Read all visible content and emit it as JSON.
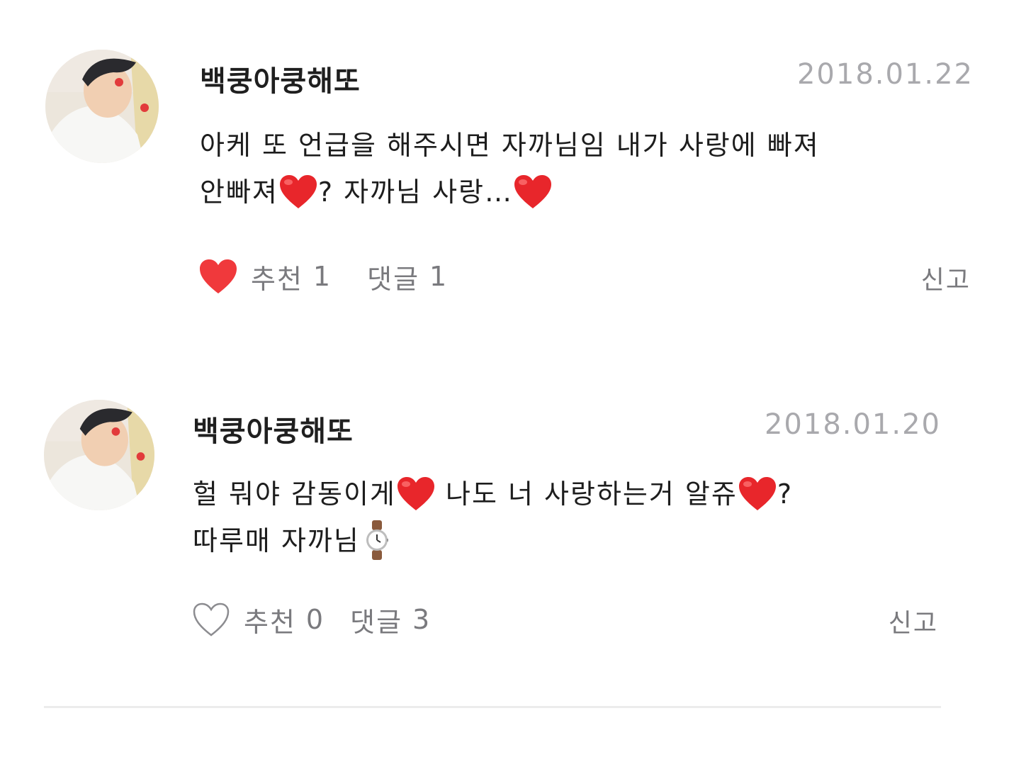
{
  "comments": [
    {
      "username": "백쿵아쿵해또",
      "date": "2018.01.22",
      "text_line1": "아케 또 언급을 해주시면 자까님임 내가 사랑에 빠져",
      "text_line2_a": "안빠져",
      "text_line2_b": "? 자까님 사랑…",
      "liked": true,
      "like_label": "추천",
      "like_count": "1",
      "reply_label": "댓글",
      "reply_count": "1",
      "report_label": "신고"
    },
    {
      "username": "백쿵아쿵해또",
      "date": "2018.01.20",
      "text_line1_a": "헐 뭐야 감동이게",
      "text_line1_b": "나도 너 사랑하는거 알쥬",
      "text_line1_c": "?",
      "text_line2": "따루매 자까님",
      "liked": false,
      "like_label": "추천",
      "like_count": "0",
      "reply_label": "댓글",
      "reply_count": "3",
      "report_label": "신고"
    }
  ],
  "icons": {
    "like_filled": "heart-filled-icon",
    "like_outline": "heart-outline-icon",
    "emoji_heart": "red-heart-emoji",
    "emoji_watch": "watch-emoji"
  },
  "colors": {
    "heart_red": "#f0393c",
    "date_gray": "#a9a9ad",
    "action_gray": "#7a7a7e",
    "divider": "#ececec"
  }
}
